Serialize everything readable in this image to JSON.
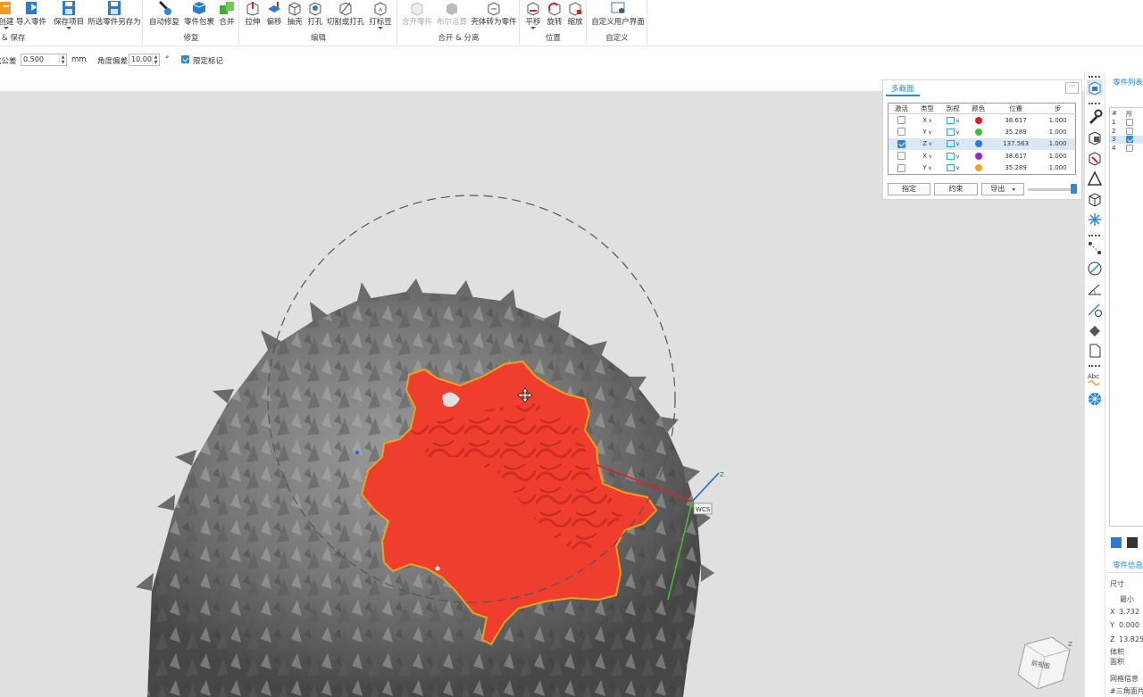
{
  "ribbon": {
    "groups": {
      "create_save": "& 保存",
      "repair": "修复",
      "edit": "编辑",
      "combine_separate": "合开 & 分离",
      "position": "位置",
      "customize": "自定义"
    },
    "buttons": {
      "create": "创建",
      "import_part": "导入零件",
      "save_project": "保存项目",
      "save_selected_as": "所选零件另存为",
      "auto_repair": "自动修复",
      "part_wrap": "零件包裹",
      "merge": "合并",
      "extrude": "拉伸",
      "offset": "偏移",
      "shell": "抽壳",
      "punch": "打孔",
      "cut_or_punch": "切割或打孔",
      "label": "打标签",
      "merge_parts": "合开零件",
      "boolean": "布尔运算",
      "shell_to_part": "壳体转为零件",
      "translate": "平移",
      "rotate": "旋转",
      "scale": "缩放",
      "custom_ui": "自定义用户界面"
    }
  },
  "options": {
    "tolerance_label": "弦公差",
    "tolerance_value": "0.500",
    "tolerance_unit": "mm",
    "angle_label": "角度偏差",
    "angle_value": "10.00",
    "angle_unit": "°",
    "limit_marker_label": "限定标记"
  },
  "section_panel": {
    "tab": "多截面",
    "more": "···",
    "headers": [
      "激活",
      "类型",
      "剖视",
      "颜色",
      "位置",
      "步"
    ],
    "rows": [
      {
        "active": false,
        "type": "X",
        "color": "#e8192c",
        "position": "38.617",
        "step": "1.000"
      },
      {
        "active": false,
        "type": "Y",
        "color": "#3fbf2f",
        "position": "35.289",
        "step": "1.000"
      },
      {
        "active": true,
        "type": "Z",
        "color": "#2f7ae0",
        "position": "137.563",
        "step": "1.000"
      },
      {
        "active": false,
        "type": "X",
        "color": "#a11ed8",
        "position": "38.617",
        "step": "1.000"
      },
      {
        "active": false,
        "type": "Y",
        "color": "#f3a51a",
        "position": "35.289",
        "step": "1.000"
      }
    ],
    "buttons": {
      "assign": "指定",
      "constraint": "约束",
      "export": "导出"
    }
  },
  "viewport": {
    "wcs_label": "WCS",
    "axis_z": "Z",
    "viewcube_face": "前视图",
    "viewcube_axis": "Z"
  },
  "part_panel": {
    "tab_list": "零件列表",
    "col_num": "#",
    "col_all": "所",
    "row_nums": [
      "1",
      "2",
      "3",
      "4"
    ],
    "row_checks": [
      false,
      false,
      true,
      false
    ],
    "tab_info": "零件信息",
    "size_label": "尺寸",
    "min_label": "最小",
    "x_label": "X",
    "x_value": "3.732",
    "y_label": "Y",
    "y_value": "0.000",
    "z_label": "Z",
    "z_value": "13.825",
    "volume_label": "体积",
    "area_label": "面积",
    "mesh_label": "网格信息",
    "triangles_label": "#三角面片"
  }
}
